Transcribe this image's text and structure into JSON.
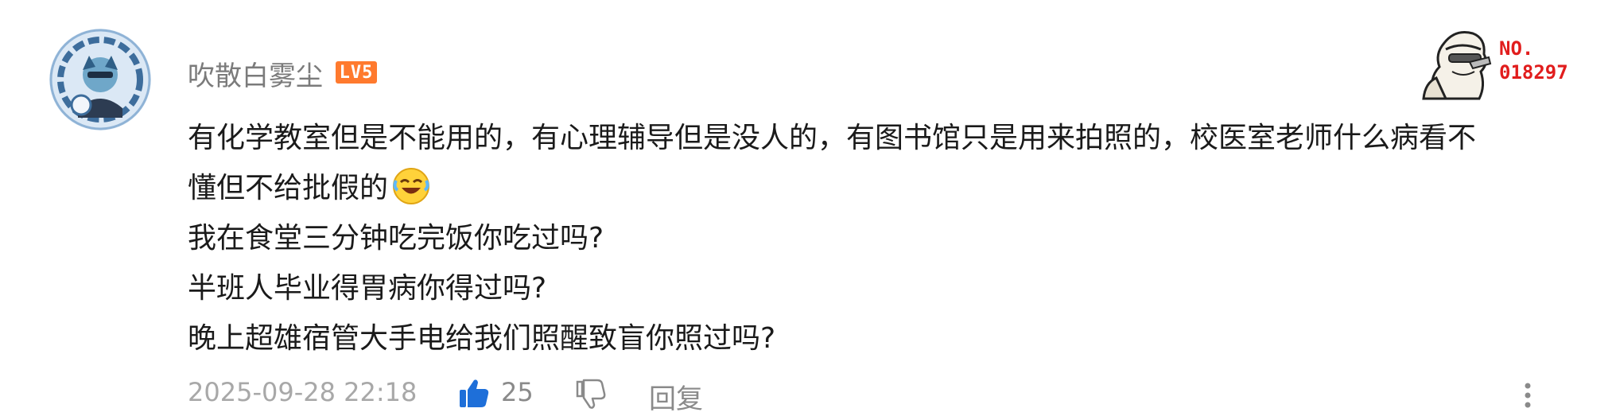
{
  "comment": {
    "user": {
      "name": "吹散白雾尘",
      "level": "LV5"
    },
    "badge": {
      "line1": "NO.",
      "line2": "018297"
    },
    "content": [
      "有化学教室但是不能用的，有心理辅导但是没人的，有图书馆只是用来拍照的，校医室老师什么病看不",
      "懂但不给批假的",
      "我在食堂三分钟吃完饭你吃过吗?",
      "半班人毕业得胃病你得过吗?",
      "晚上超雄宿管大手电给我们照醒致盲你照过吗?"
    ],
    "footer": {
      "time": "2025-09-28 22:18",
      "like_count": "25",
      "reply_label": "回复"
    }
  },
  "colors": {
    "accent_like": "#1e6fd9",
    "level_badge": "#ff7a2e",
    "badge_text": "#e11d1d"
  },
  "icons": [
    "avatar",
    "laughing-emoji-icon",
    "thumbs-up-icon",
    "thumbs-down-icon",
    "more-vertical-icon"
  ]
}
